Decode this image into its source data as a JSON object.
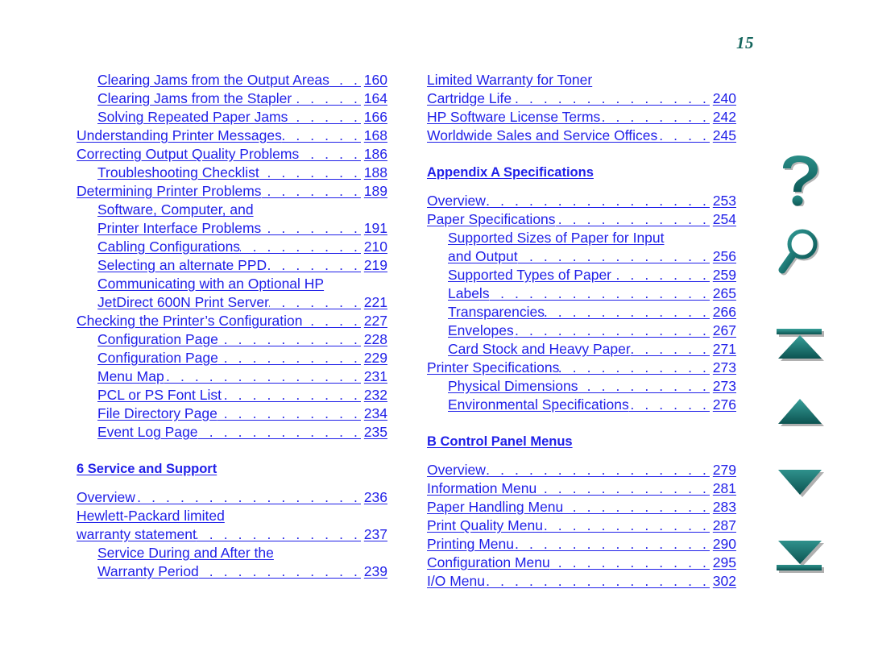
{
  "page": {
    "number": "15",
    "number_color": "#13655c",
    "link_color": "#1f1fe8",
    "icon_color": "#156e6c"
  },
  "columns": {
    "left": [
      {
        "kind": "entry",
        "indent": 1,
        "title": "Clearing Jams from the Output Areas",
        "leader": ". . . . . . . . . . . . . . . . . . . . . . . . . . . . . . . . . . . . . .",
        "page": "160"
      },
      {
        "kind": "entry",
        "indent": 1,
        "title": "Clearing Jams from the Stapler",
        "leader": ". . . . . . . . . . . . . . . . . . . . . . . . . . . . . . . . . . . . . .",
        "page": "164"
      },
      {
        "kind": "entry",
        "indent": 1,
        "title": "Solving Repeated Paper Jams",
        "leader": ". . . . . . . . . . . . . . . . . . . . . . . . . . . . . . . . . . . . . .",
        "page": "166"
      },
      {
        "kind": "entry",
        "indent": 0,
        "title": "Understanding Printer Messages",
        "leader": ". . . . . . . . . . . . . . . . . . . . . . . . . . . . . . . . . . . . . .",
        "page": "168"
      },
      {
        "kind": "entry",
        "indent": 0,
        "title": "Correcting Output Quality Problems",
        "leader": ". . . . . . . . . . . . . . . . . . . . . . . . . . . . . . . . . . . . . .",
        "page": "186"
      },
      {
        "kind": "entry",
        "indent": 1,
        "title": "Troubleshooting Checklist",
        "leader": ". . . . . . . . . . . . . . . . . . . . . . . . . . . . . . . . . . . . . .",
        "page": "188"
      },
      {
        "kind": "entry",
        "indent": 0,
        "title": "Determining Printer Problems",
        "leader": ". . . . . . . . . . . . . . . . . . . . . . . . . . . . . . . . . . . . . .",
        "page": "189"
      },
      {
        "kind": "cont",
        "indent": 1,
        "title": "Software, Computer, and"
      },
      {
        "kind": "entry",
        "indent": 1,
        "title": "Printer Interface Problems",
        "leader": ". . . . . . . . . . . . . . . . . . . . . . . . . . . . . . . . . . . . . .",
        "page": "191"
      },
      {
        "kind": "entry",
        "indent": 1,
        "title": "Cabling Configurations",
        "leader": ". . . . . . . . . . . . . . . . . . . . . . . . . . . . . . . . . . . . . .",
        "page": "210"
      },
      {
        "kind": "entry",
        "indent": 1,
        "title": "Selecting an alternate PPD",
        "leader": ". . . . . . . . . . . . . . . . . . . . . . . . . . . . . . . . . . . . . .",
        "page": "219"
      },
      {
        "kind": "cont",
        "indent": 1,
        "title": "Communicating with an Optional HP"
      },
      {
        "kind": "entry",
        "indent": 1,
        "title": "JetDirect 600N Print Server",
        "leader": ". . . . . . . . . . . . . . . . . . . . . . . . . . . . . . . . . . . . . .",
        "page": "221"
      },
      {
        "kind": "entry",
        "indent": 0,
        "title": "Checking the Printer’s Configuration",
        "leader": ". . . . . . . . . . . . . . . . . . . . . . . . . . . . . . . . . . . . . .",
        "page": "227"
      },
      {
        "kind": "entry",
        "indent": 1,
        "title": "Configuration Page",
        "leader": ". . . . . . . . . . . . . . . . . . . . . . . . . . . . . . . . . . . . . .",
        "page": "228"
      },
      {
        "kind": "entry",
        "indent": 1,
        "title": "Configuration Page",
        "leader": ". . . . . . . . . . . . . . . . . . . . . . . . . . . . . . . . . . . . . .",
        "page": "229"
      },
      {
        "kind": "entry",
        "indent": 1,
        "title": "Menu Map",
        "leader": ". . . . . . . . . . . . . . . . . . . . . . . . . . . . . . . . . . . . . .",
        "page": "231"
      },
      {
        "kind": "entry",
        "indent": 1,
        "title": "PCL or PS Font List",
        "leader": ". . . . . . . . . . . . . . . . . . . . . . . . . . . . . . . . . . . . . .",
        "page": "232"
      },
      {
        "kind": "entry",
        "indent": 1,
        "title": "File Directory Page",
        "leader": ". . . . . . . . . . . . . . . . . . . . . . . . . . . . . . . . . . . . . .",
        "page": "234"
      },
      {
        "kind": "entry",
        "indent": 1,
        "title": "Event Log Page",
        "leader": ". . . . . . . . . . . . . . . . . . . . . . . . . . . . . . . . . . . . . .",
        "page": "235"
      },
      {
        "kind": "spacer"
      },
      {
        "kind": "heading",
        "title": "6 Service and Support"
      },
      {
        "kind": "spacer-half"
      },
      {
        "kind": "entry",
        "indent": 0,
        "title": "Overview",
        "leader": ". . . . . . . . . . . . . . . . . . . . . . . . . . . . . . . . . . . . . .",
        "page": "236"
      },
      {
        "kind": "cont",
        "indent": 0,
        "title": "Hewlett-Packard limited"
      },
      {
        "kind": "entry",
        "indent": 0,
        "title": "warranty statement",
        "leader": ". . . . . . . . . . . . . . . . . . . . . . . . . . . . . . . . . . . . . .",
        "page": "237"
      },
      {
        "kind": "cont",
        "indent": 1,
        "title": "Service During and After the"
      },
      {
        "kind": "entry",
        "indent": 1,
        "title": "Warranty Period",
        "leader": ". . . . . . . . . . . . . . . . . . . . . . . . . . . . . . . . . . . . . .",
        "page": "239"
      }
    ],
    "right": [
      {
        "kind": "cont",
        "indent": 0,
        "title": "Limited Warranty for Toner"
      },
      {
        "kind": "entry",
        "indent": 0,
        "title": "Cartridge Life",
        "leader": ". . . . . . . . . . . . . . . . . . . . . . . . . . . . . . . . . . . . . .",
        "page": "240"
      },
      {
        "kind": "entry",
        "indent": 0,
        "title": "HP Software License Terms",
        "leader": ". . . . . . . . . . . . . . . . . . . . . . . . . . . . . . . . . . . . . .",
        "page": "242"
      },
      {
        "kind": "entry",
        "indent": 0,
        "title": "Worldwide Sales and Service Offices",
        "leader": ". . . . . . . . . . . . . . . . . . . . . . . . . . . . . . . . . . . . . .",
        "page": "245"
      },
      {
        "kind": "spacer"
      },
      {
        "kind": "heading",
        "title": "Appendix A Specifications"
      },
      {
        "kind": "spacer-half"
      },
      {
        "kind": "entry",
        "indent": 0,
        "title": "Overview",
        "leader": ". . . . . . . . . . . . . . . . . . . . . . . . . . . . . . . . . . . . . .",
        "page": "253"
      },
      {
        "kind": "entry",
        "indent": 0,
        "title": "Paper Specifications",
        "leader": ". . . . . . . . . . . . . . . . . . . . . . . . . . . . . . . . . . . . . .",
        "page": "254"
      },
      {
        "kind": "cont",
        "indent": 1,
        "title": "Supported Sizes of Paper for Input"
      },
      {
        "kind": "entry",
        "indent": 1,
        "title": "and Output",
        "leader": ". . . . . . . . . . . . . . . . . . . . . . . . . . . . . . . . . . . . . .",
        "page": "256"
      },
      {
        "kind": "entry",
        "indent": 1,
        "title": "Supported Types of Paper",
        "leader": ". . . . . . . . . . . . . . . . . . . . . . . . . . . . . . . . . . . . . .",
        "page": "259"
      },
      {
        "kind": "entry",
        "indent": 1,
        "title": "Labels",
        "leader": ". . . . . . . . . . . . . . . . . . . . . . . . . . . . . . . . . . . . . .",
        "page": "265"
      },
      {
        "kind": "entry",
        "indent": 1,
        "title": "Transparencies",
        "leader": ". . . . . . . . . . . . . . . . . . . . . . . . . . . . . . . . . . . . . .",
        "page": "266"
      },
      {
        "kind": "entry",
        "indent": 1,
        "title": "Envelopes",
        "leader": ". . . . . . . . . . . . . . . . . . . . . . . . . . . . . . . . . . . . . .",
        "page": "267"
      },
      {
        "kind": "entry",
        "indent": 1,
        "title": "Card Stock and Heavy Paper",
        "leader": ". . . . . . . . . . . . . . . . . . . . . . . . . . . . . . . . . . . . . .",
        "page": "271"
      },
      {
        "kind": "entry",
        "indent": 0,
        "title": "Printer Specifications",
        "leader": ". . . . . . . . . . . . . . . . . . . . . . . . . . . . . . . . . . . . . .",
        "page": "273"
      },
      {
        "kind": "entry",
        "indent": 1,
        "title": "Physical Dimensions",
        "leader": ". . . . . . . . . . . . . . . . . . . . . . . . . . . . . . . . . . . . . .",
        "page": "273"
      },
      {
        "kind": "entry",
        "indent": 1,
        "title": "Environmental Specifications",
        "leader": ". . . . . . . . . . . . . . . . . . . . . . . . . . . . . . . . . . . . . .",
        "page": "276"
      },
      {
        "kind": "spacer"
      },
      {
        "kind": "heading",
        "title": "B Control Panel Menus"
      },
      {
        "kind": "spacer-half"
      },
      {
        "kind": "entry",
        "indent": 0,
        "title": "Overview",
        "leader": ". . . . . . . . . . . . . . . . . . . . . . . . . . . . . . . . . . . . . .",
        "page": "279"
      },
      {
        "kind": "entry",
        "indent": 0,
        "title": "Information Menu",
        "leader": ". . . . . . . . . . . . . . . . . . . . . . . . . . . . . . . . . . . . . .",
        "page": "281"
      },
      {
        "kind": "entry",
        "indent": 0,
        "title": "Paper Handling Menu",
        "leader": ". . . . . . . . . . . . . . . . . . . . . . . . . . . . . . . . . . . . . .",
        "page": "283"
      },
      {
        "kind": "entry",
        "indent": 0,
        "title": "Print Quality Menu",
        "leader": ". . . . . . . . . . . . . . . . . . . . . . . . . . . . . . . . . . . . . .",
        "page": "287"
      },
      {
        "kind": "entry",
        "indent": 0,
        "title": "Printing Menu",
        "leader": ". . . . . . . . . . . . . . . . . . . . . . . . . . . . . . . . . . . . . .",
        "page": "290"
      },
      {
        "kind": "entry",
        "indent": 0,
        "title": "Configuration Menu",
        "leader": ". . . . . . . . . . . . . . . . . . . . . . . . . . . . . . . . . . . . . .",
        "page": "295"
      },
      {
        "kind": "entry",
        "indent": 0,
        "title": "I/O Menu",
        "leader": ". . . . . . . . . . . . . . . . . . . . . . . . . . . . . . . . . . . . . .",
        "page": "302"
      }
    ]
  },
  "nav_rail": [
    {
      "id": "help",
      "icon": "question-mark-icon",
      "label": "Help"
    },
    {
      "id": "search",
      "icon": "magnifier-icon",
      "label": "Search"
    },
    {
      "id": "first",
      "icon": "first-page-arrow-icon",
      "label": "First Page"
    },
    {
      "id": "prev",
      "icon": "previous-page-arrow-icon",
      "label": "Previous Page"
    },
    {
      "id": "next",
      "icon": "next-page-arrow-icon",
      "label": "Next Page"
    },
    {
      "id": "last",
      "icon": "last-page-arrow-icon",
      "label": "Last Page"
    }
  ]
}
